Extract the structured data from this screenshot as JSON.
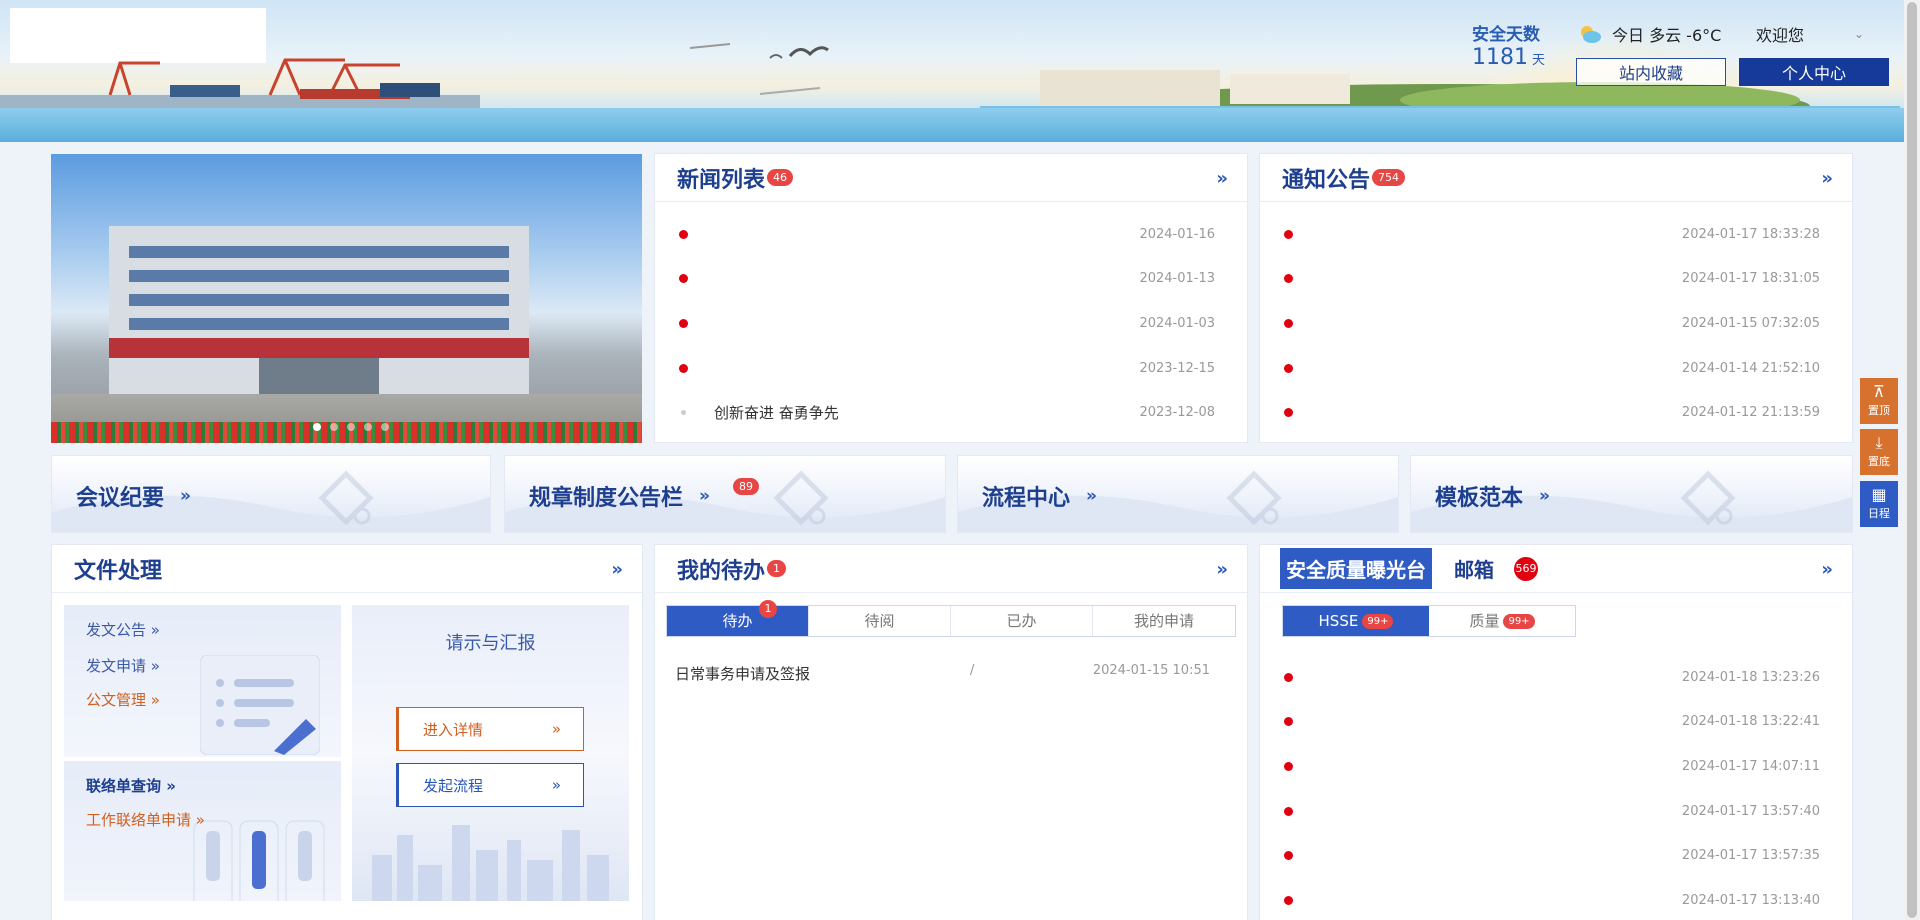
{
  "header": {
    "safety_label": "安全天数",
    "safety_days": "1181",
    "safety_unit": "天",
    "weather": "今日 多云 -6°C",
    "welcome": "欢迎您",
    "favorites_button": "站内收藏",
    "personal_button": "个人中心"
  },
  "news": {
    "title": "新闻列表",
    "badge": "46",
    "items": [
      {
        "text": "",
        "date": "2024-01-16"
      },
      {
        "text": "",
        "date": "2024-01-13"
      },
      {
        "text": "",
        "date": "2024-01-03"
      },
      {
        "text": "",
        "date": "2023-12-15"
      },
      {
        "text": "创新奋进 奋勇争先",
        "date": "2023-12-08"
      }
    ]
  },
  "notice": {
    "title": "通知公告",
    "badge": "754",
    "items": [
      {
        "date": "2024-01-17 18:33:28"
      },
      {
        "date": "2024-01-17 18:31:05"
      },
      {
        "date": "2024-01-15 07:32:05"
      },
      {
        "date": "2024-01-14 21:52:10"
      },
      {
        "date": "2024-01-12 21:13:59"
      }
    ]
  },
  "banners": {
    "meeting": "会议纪要",
    "rules": "规章制度公告栏",
    "rules_badge": "89",
    "process": "流程中心",
    "template": "模板范本"
  },
  "files": {
    "title": "文件处理",
    "links": {
      "notice": "发文公告",
      "apply": "发文申请",
      "manage": "公文管理",
      "contact_query": "联络单查询",
      "contact_apply": "工作联络单申请"
    },
    "report_title": "请示与汇报",
    "enter_detail": "进入详情",
    "start_process": "发起流程"
  },
  "todo": {
    "title": "我的待办",
    "badge": "1",
    "tabs": [
      "待办",
      "待阅",
      "已办",
      "我的申请"
    ],
    "tab_badge": "1",
    "row": {
      "text": "日常事务申请及签报",
      "slash": "/",
      "date": "2024-01-15 10:51"
    }
  },
  "quality": {
    "tab1": "安全质量曝光台",
    "tab2": "邮箱",
    "mail_badge": "569",
    "sub_tabs": [
      {
        "label": "HSSE",
        "badge": "99+"
      },
      {
        "label": "质量",
        "badge": "99+"
      }
    ],
    "items": [
      {
        "date": "2024-01-18 13:23:26"
      },
      {
        "date": "2024-01-18 13:22:41"
      },
      {
        "date": "2024-01-17 14:07:11"
      },
      {
        "date": "2024-01-17 13:57:40"
      },
      {
        "date": "2024-01-17 13:57:35"
      },
      {
        "date": "2024-01-17 13:13:40"
      }
    ]
  },
  "side": {
    "top": "置顶",
    "bottom": "置底",
    "calendar": "日程"
  },
  "colors": {
    "primary": "#2f5bc4",
    "title": "#1e3f8f",
    "accent": "#d6712e",
    "badge": "#e84545"
  }
}
